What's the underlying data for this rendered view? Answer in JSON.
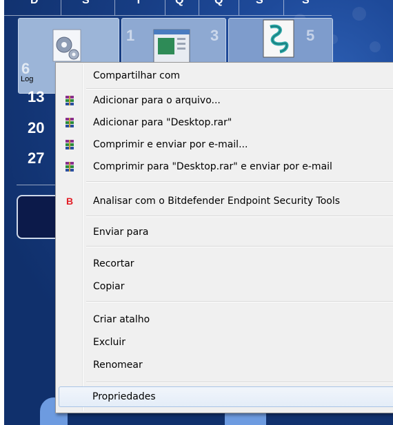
{
  "calendar": {
    "weekday_headers": [
      "D",
      "S",
      "T",
      "Q",
      "Q",
      "S",
      "S"
    ],
    "week_rows": [
      "6",
      "13",
      "20",
      "27"
    ],
    "tile_days": [
      "1",
      "3",
      "5"
    ],
    "tile_label": "Log"
  },
  "menu": {
    "items": [
      {
        "label": "Compartilhar com",
        "icon": null
      },
      {
        "label": "Adicionar para o arquivo...",
        "icon": "winrar-icon"
      },
      {
        "label": "Adicionar para \"Desktop.rar\"",
        "icon": "winrar-icon"
      },
      {
        "label": "Comprimir e enviar por e-mail...",
        "icon": "winrar-icon"
      },
      {
        "label": "Comprimir para \"Desktop.rar\" e enviar por e-mail",
        "icon": "winrar-icon"
      },
      {
        "label": "Analisar com o Bitdefender Endpoint Security Tools",
        "icon": "bitdefender-icon",
        "icon_text": "B"
      },
      {
        "label": "Enviar para",
        "icon": null
      },
      {
        "label": "Recortar",
        "icon": null
      },
      {
        "label": "Copiar",
        "icon": null
      },
      {
        "label": "Criar atalho",
        "icon": null
      },
      {
        "label": "Excluir",
        "icon": null
      },
      {
        "label": "Renomear",
        "icon": null
      },
      {
        "label": "Propriedades",
        "icon": null,
        "highlighted": true
      }
    ]
  },
  "colors": {
    "desktop_blue": "#1e4a9a",
    "menu_bg": "#f0f0f0",
    "hover_border": "#a8c4e6",
    "bitdefender_red": "#e21e26"
  }
}
